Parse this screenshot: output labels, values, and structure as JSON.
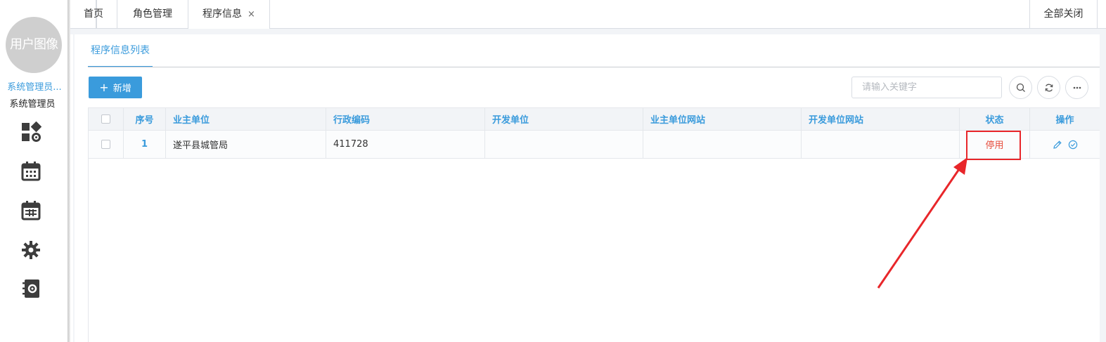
{
  "sidebar": {
    "avatar_text": "用户图像",
    "user_link": "系统管理员...",
    "user_role": "系统管理员",
    "icons": [
      "dashboard-gear-icon",
      "calendar-icon",
      "calendar-grid-icon",
      "settings-cog-icon",
      "notebook-gear-icon"
    ]
  },
  "tabs": [
    {
      "label": "首页"
    },
    {
      "label": "角色管理"
    },
    {
      "label": "程序信息",
      "close": "×"
    }
  ],
  "close_all_label": "全部关闭",
  "subtab_label": "程序信息列表",
  "toolbar": {
    "add_label": "新增",
    "add_icon": "+",
    "search_placeholder": "请输入关键字"
  },
  "table": {
    "headers": {
      "index": "序号",
      "owner": "业主单位",
      "admin_code": "行政编码",
      "developer": "开发单位",
      "owner_site": "业主单位网站",
      "developer_site": "开发单位网站",
      "status": "状态",
      "actions": "操作"
    },
    "rows": [
      {
        "index": "1",
        "owner": "遂平县城管局",
        "admin_code": "411728",
        "developer": "",
        "owner_site": "",
        "developer_site": "",
        "status": "停用"
      }
    ]
  },
  "colors": {
    "accent": "#3a9bdc",
    "annotation": "#e8262a",
    "status_disabled": "#e74c3c"
  }
}
